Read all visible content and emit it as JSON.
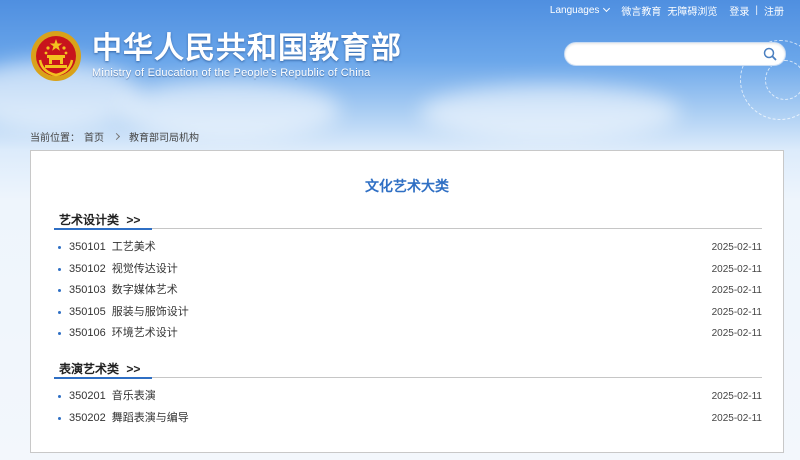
{
  "topbar": {
    "languages": "Languages",
    "links": [
      "微言教育",
      "无障碍浏览",
      "登录",
      "注册"
    ]
  },
  "header": {
    "title_cn": "中华人民共和国教育部",
    "title_en": "Ministry of Education of the People's Republic of China"
  },
  "search": {
    "placeholder": "",
    "value": ""
  },
  "breadcrumb": {
    "prefix": "当前位置：",
    "home": "首页",
    "current": "教育部司局机构"
  },
  "main": {
    "title": "文化艺术大类",
    "sections": [
      {
        "title": "艺术设计类",
        "more": ">>",
        "items": [
          {
            "code": "350101",
            "name": "工艺美术",
            "date": "2025-02-11"
          },
          {
            "code": "350102",
            "name": "视觉传达设计",
            "date": "2025-02-11"
          },
          {
            "code": "350103",
            "name": "数字媒体艺术",
            "date": "2025-02-11"
          },
          {
            "code": "350105",
            "name": "服装与服饰设计",
            "date": "2025-02-11"
          },
          {
            "code": "350106",
            "name": "环境艺术设计",
            "date": "2025-02-11"
          }
        ]
      },
      {
        "title": "表演艺术类",
        "more": ">>",
        "items": [
          {
            "code": "350201",
            "name": "音乐表演",
            "date": "2025-02-11"
          },
          {
            "code": "350202",
            "name": "舞蹈表演与编导",
            "date": "2025-02-11"
          }
        ]
      }
    ]
  },
  "colors": {
    "accent": "#2f6fc4",
    "header_blue": "#4f8fe0"
  },
  "icons": {
    "emblem": "national-emblem-icon",
    "search": "search-icon"
  }
}
